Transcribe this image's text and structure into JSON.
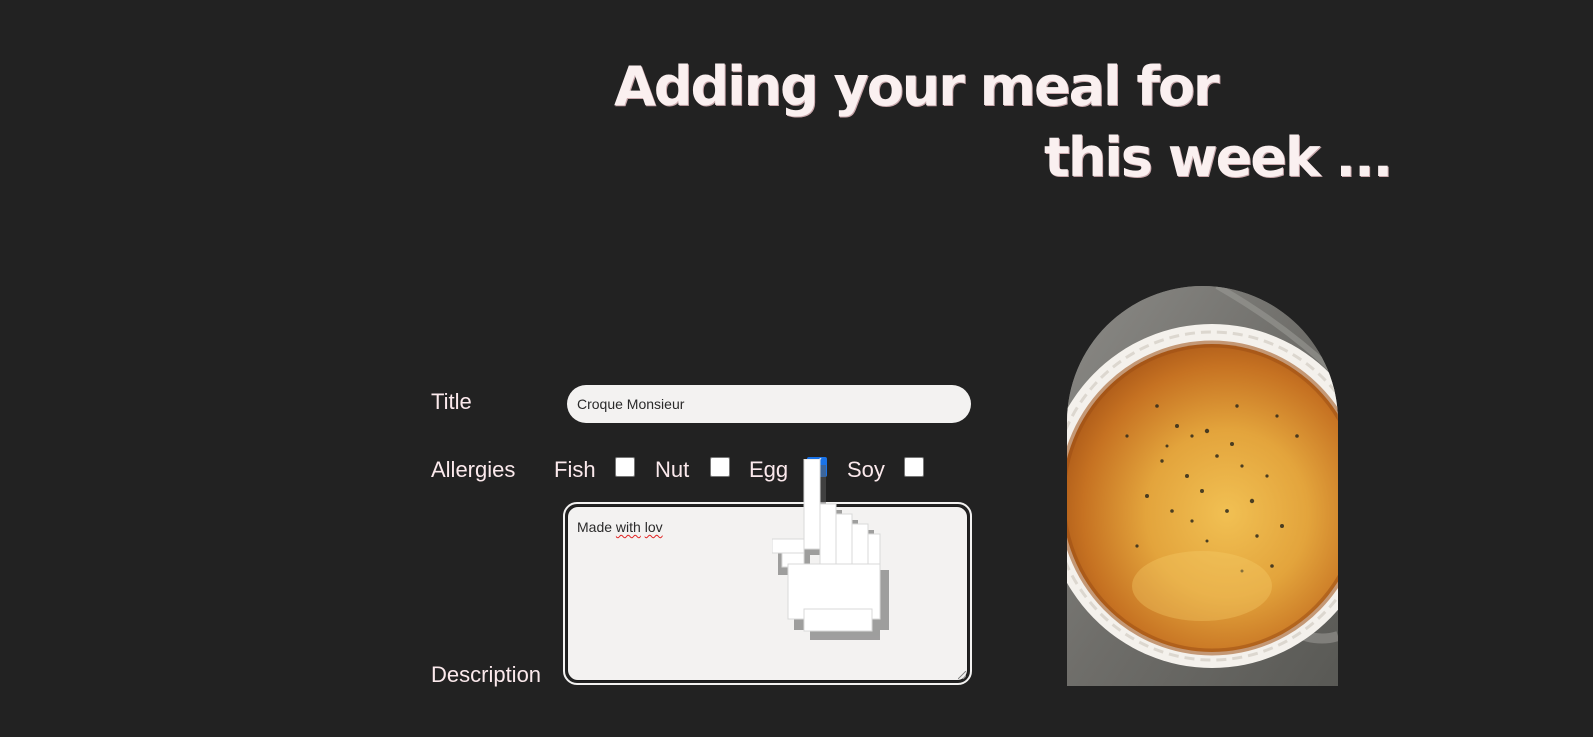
{
  "heading": {
    "line1": "Adding your meal for",
    "line2": "this week ..."
  },
  "form": {
    "title_label": "Title",
    "title_value": "Croque Monsieur",
    "allergies_label": "Allergies",
    "allergies": [
      {
        "label": "Fish",
        "checked": false
      },
      {
        "label": "Nut",
        "checked": false
      },
      {
        "label": "Egg",
        "checked": true
      },
      {
        "label": "Soy",
        "checked": false
      }
    ],
    "description_label": "Description",
    "description_prefix": "Made ",
    "description_misspelled_1": "with",
    "description_space": " ",
    "description_misspelled_2": "lov"
  },
  "image": {
    "subject": "quiche in white fluted dish",
    "shape": "arch"
  },
  "cursor": {
    "icon": "pointer-hand-icon"
  },
  "colors": {
    "background": "#222222",
    "heading": "#faf0f0",
    "label": "#fbe9ec",
    "field": "#f3f2f1",
    "checkbox_checked": "#1a73e8"
  }
}
